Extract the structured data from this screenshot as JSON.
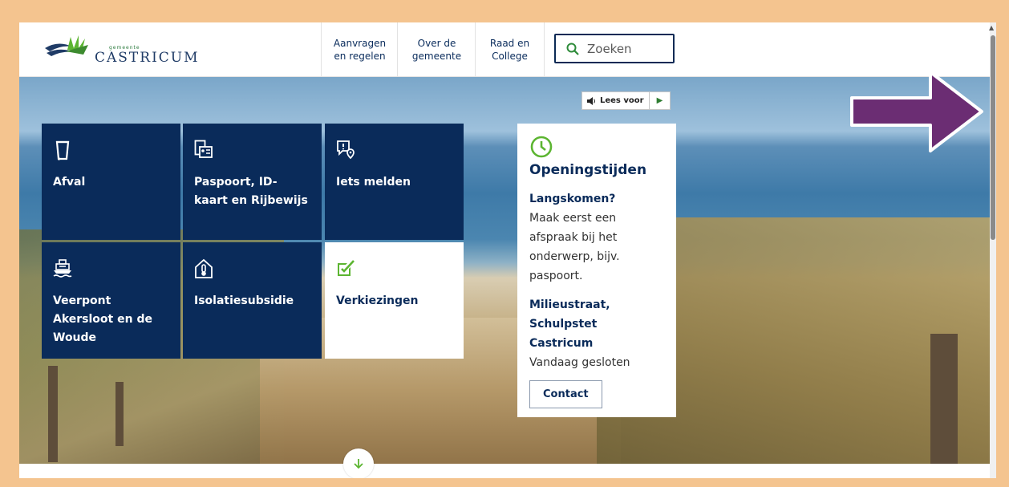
{
  "header": {
    "logo_small": "gemeente",
    "logo_text": "CASTRICUM",
    "nav": [
      {
        "label": "Aanvragen\nen regelen"
      },
      {
        "label": "Over de\ngemeente"
      },
      {
        "label": "Raad en\nCollege"
      }
    ],
    "search": {
      "placeholder": "Zoeken"
    }
  },
  "reader": {
    "label": "Lees voor",
    "play_symbol": "▶"
  },
  "tiles": [
    {
      "label": "Afval",
      "icon": "trash-bin-icon"
    },
    {
      "label": "Paspoort, ID-kaart en Rijbewijs",
      "icon": "id-card-icon"
    },
    {
      "label": "Iets melden",
      "icon": "report-location-icon"
    },
    {
      "label": "Veerpont Akersloot en de Woude",
      "icon": "ferry-icon"
    },
    {
      "label": "Isolatiesubsidie",
      "icon": "house-thermometer-icon"
    },
    {
      "label": "Verkiezingen",
      "icon": "ballot-check-icon"
    }
  ],
  "opening": {
    "title": "Openingstijden",
    "section1_title": "Langskomen?",
    "section1_text": "Maak eerst een afspraak bij het onderwerp, bijv. paspoort.",
    "section2_title": "Milieustraat, Schulpstet Castricum",
    "section2_text": "Vandaag gesloten",
    "contact_label": "Contact"
  },
  "colors": {
    "navy": "#0a2b5a",
    "green": "#5cb531",
    "arrow": "#6b2d73",
    "frame": "#f4c48f"
  }
}
